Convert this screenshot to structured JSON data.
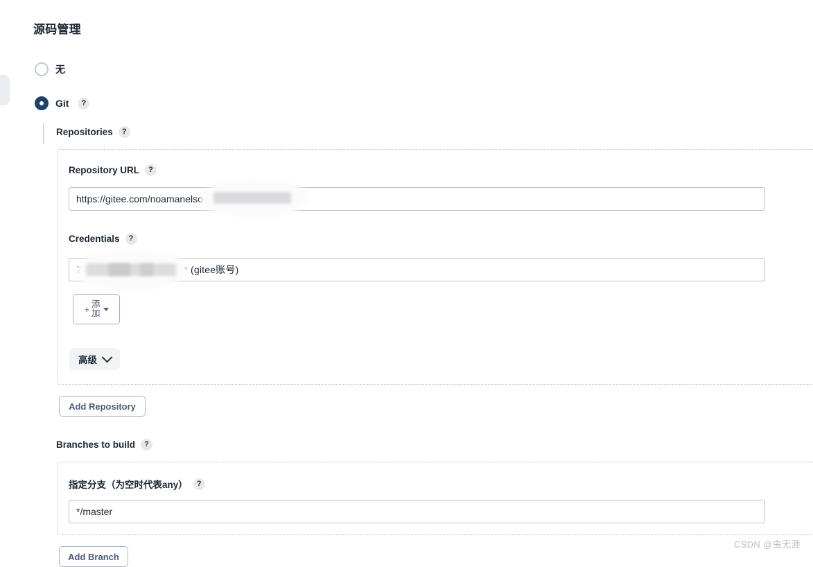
{
  "page": {
    "title": "源码管理"
  },
  "scm_options": [
    {
      "label": "无",
      "selected": false,
      "has_help": false
    },
    {
      "label": "Git",
      "selected": true,
      "has_help": true
    }
  ],
  "help_glyph": "?",
  "sections": {
    "repositories": {
      "label": "Repositories",
      "repository_url": {
        "label": "Repository URL",
        "value": "https://gitee.com/noamanelso                    ur.git",
        "placeholder": ""
      },
      "credentials": {
        "label": "Credentials",
        "value_prefix": "768",
        "value_suffix": "*** (gitee账号)"
      },
      "add_button": {
        "label": "添 加",
        "label_line1": "添",
        "label_line2": "加",
        "plus_glyph": "+"
      },
      "advanced_button": {
        "label": "高级"
      }
    },
    "add_repository_button": {
      "label": "Add Repository"
    },
    "branches": {
      "label": "Branches to build",
      "branch_specifier": {
        "label": "指定分支（为空时代表any）",
        "value": "*/master"
      }
    },
    "add_branch_button": {
      "label": "Add Branch"
    }
  },
  "watermark": "CSDN @虫无涯",
  "colors": {
    "accent_navy": "#1d4368",
    "border_input": "#b7c2ca",
    "dashed_border": "#c2cbd3",
    "button_text": "#4b5a78",
    "pill_bg": "#f2f3f5"
  }
}
